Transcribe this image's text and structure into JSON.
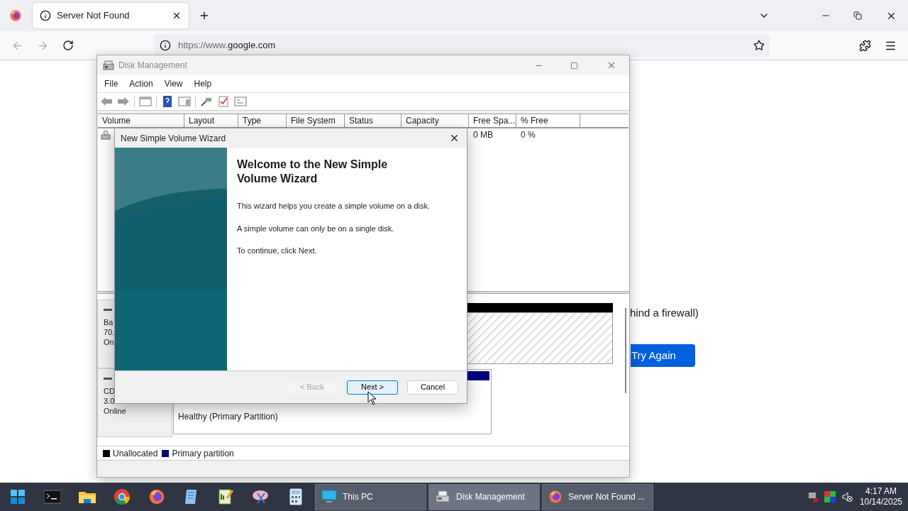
{
  "browser": {
    "tab": {
      "title": "Server Not Found",
      "selected": true
    },
    "url_prefix": "https://www.",
    "url_domain": "google.com",
    "page": {
      "message": "hind a firewall)",
      "button": "Try Again"
    }
  },
  "disk_management": {
    "title": "Disk Management",
    "menu": [
      "File",
      "Action",
      "View",
      "Help"
    ],
    "columns": [
      "Volume",
      "Layout",
      "Type",
      "File System",
      "Status",
      "Capacity",
      "Free Spa...",
      "% Free"
    ],
    "rows": [
      {
        "free_space": "0 MB",
        "percent_free": "0 %"
      }
    ],
    "disks": [
      {
        "lines": [
          "Ba",
          "70.",
          "On"
        ],
        "partition": {
          "kind": "unallocated"
        }
      },
      {
        "lines": [
          "CD",
          "3.0",
          "Online"
        ],
        "partition": {
          "kind": "primary",
          "status": "Healthy (Primary Partition)"
        }
      }
    ],
    "legend": [
      {
        "label": "Unallocated",
        "color": "#000000"
      },
      {
        "label": "Primary partition",
        "color": "#000080"
      }
    ]
  },
  "wizard": {
    "title": "New Simple Volume Wizard",
    "heading": "Welcome to the New Simple Volume Wizard",
    "paragraphs": [
      "This wizard helps you create a simple volume on a disk.",
      "A simple volume can only be on a single disk.",
      "To continue, click Next."
    ],
    "buttons": [
      {
        "label": "< Back",
        "disabled": true,
        "default": false
      },
      {
        "label": "Next >",
        "disabled": false,
        "default": true
      },
      {
        "label": "Cancel",
        "disabled": false,
        "default": false
      }
    ]
  },
  "taskbar": {
    "windows": [
      {
        "label": "This PC",
        "selected": false
      },
      {
        "label": "Disk Management",
        "selected": true
      },
      {
        "label": "Server Not Found ...",
        "selected": false
      }
    ],
    "time": "4:17 AM",
    "date": "10/14/2025"
  }
}
